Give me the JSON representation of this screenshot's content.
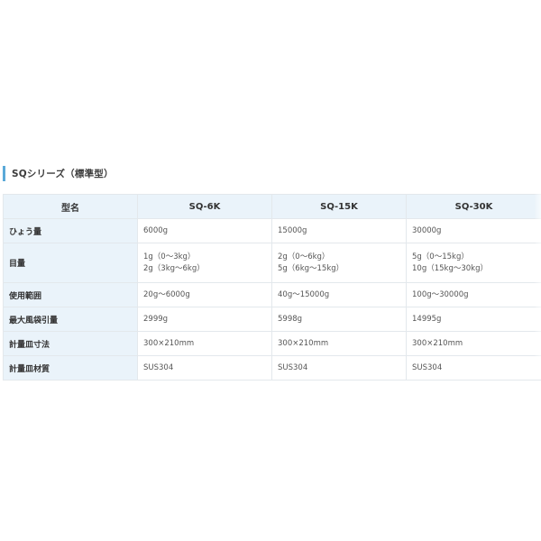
{
  "section": {
    "title": "SQシリーズ（標準型）"
  },
  "table": {
    "header": {
      "label": "型名",
      "models": [
        "SQ-6K",
        "SQ-15K",
        "SQ-30K"
      ]
    },
    "rows": [
      {
        "label": "ひょう量",
        "values": [
          [
            "6000g"
          ],
          [
            "15000g"
          ],
          [
            "30000g"
          ]
        ]
      },
      {
        "label": "目量",
        "values": [
          [
            "1g（0～3kg）",
            "2g（3kg～6kg）"
          ],
          [
            "2g（0～6kg）",
            "5g（6kg～15kg）"
          ],
          [
            "5g（0～15kg）",
            "10g（15kg～30kg）"
          ]
        ]
      },
      {
        "label": "使用範囲",
        "values": [
          [
            "20g～6000g"
          ],
          [
            "40g～15000g"
          ],
          [
            "100g～30000g"
          ]
        ]
      },
      {
        "label": "最大風袋引量",
        "values": [
          [
            "2999g"
          ],
          [
            "5998g"
          ],
          [
            "14995g"
          ]
        ]
      },
      {
        "label": "計量皿寸法",
        "values": [
          [
            "300×210mm"
          ],
          [
            "300×210mm"
          ],
          [
            "300×210mm"
          ]
        ]
      },
      {
        "label": "計量皿材質",
        "values": [
          [
            "SUS304"
          ],
          [
            "SUS304"
          ],
          [
            "SUS304"
          ]
        ]
      }
    ]
  },
  "colors": {
    "accent_bar": "#5aa9d8",
    "header_bg": "#eaf3fa",
    "border": "#e3e8ec"
  }
}
